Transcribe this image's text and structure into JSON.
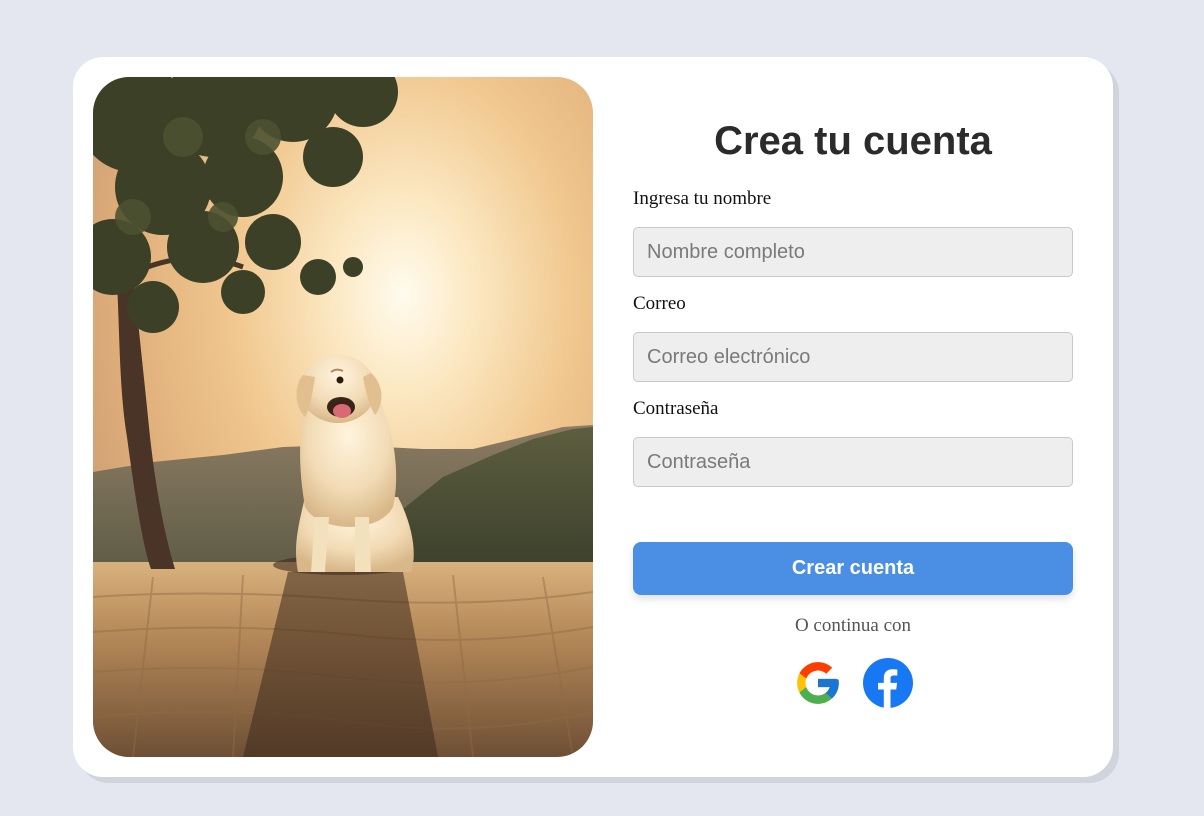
{
  "page": {
    "background_color": "#e4e7f0"
  },
  "signup": {
    "title": "Crea tu cuenta",
    "fields": [
      {
        "label": "Ingresa tu nombre",
        "placeholder": "Nombre completo",
        "value": ""
      },
      {
        "label": "Correo",
        "placeholder": "Correo electrónico",
        "value": ""
      },
      {
        "label": "Contraseña",
        "placeholder": "Contraseña",
        "value": ""
      }
    ],
    "submit_label": "Crear cuenta",
    "alt_text": "O continua con",
    "social": [
      {
        "icon": "google-icon"
      },
      {
        "icon": "facebook-icon"
      }
    ]
  },
  "colors": {
    "accent": "#4a8fe3",
    "facebook": "#1877f2",
    "input_background": "#efeeef"
  }
}
